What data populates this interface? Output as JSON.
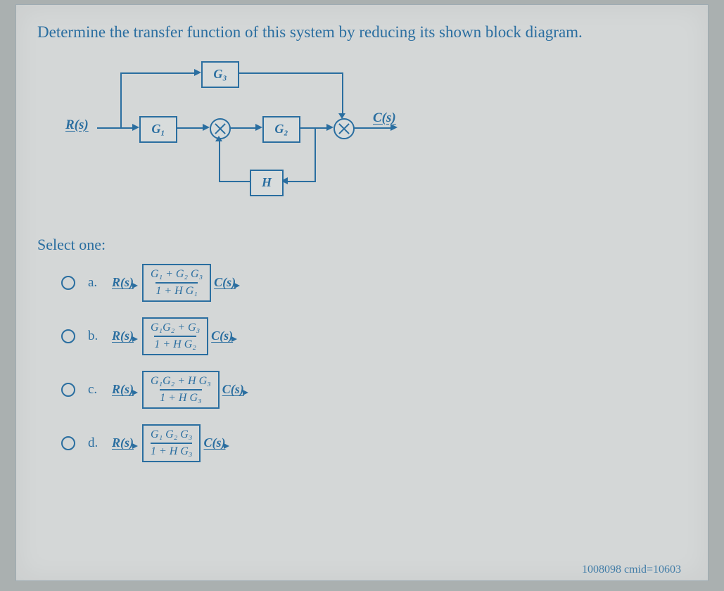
{
  "question": "Determine the transfer function of this system by reducing its shown block diagram.",
  "diagram": {
    "input_label": "R(s)",
    "output_label": "C(s)",
    "blocks": {
      "G1": "G₁",
      "G2": "G₂",
      "G3": "G₃",
      "H": "H"
    }
  },
  "select_label": "Select one:",
  "options": {
    "a": {
      "letter": "a.",
      "in": "R(s)",
      "out": "C(s)",
      "num": "G₁ + G₂ G₃",
      "den": "1 + H G₁"
    },
    "b": {
      "letter": "b.",
      "in": "R(s)",
      "out": "C(s)",
      "num": "G₁G₂ + G₃",
      "den": "1 + H G₂"
    },
    "c": {
      "letter": "c.",
      "in": "R(s)",
      "out": "C(s)",
      "num": "G₁G₂ + H G₃",
      "den": "1 + H G₃"
    },
    "d": {
      "letter": "d.",
      "in": "R(s)",
      "out": "C(s)",
      "num": "G₁ G₂ G₃",
      "den": "1 + H G₃"
    }
  },
  "footer_id": "1008098 cmid=10603"
}
